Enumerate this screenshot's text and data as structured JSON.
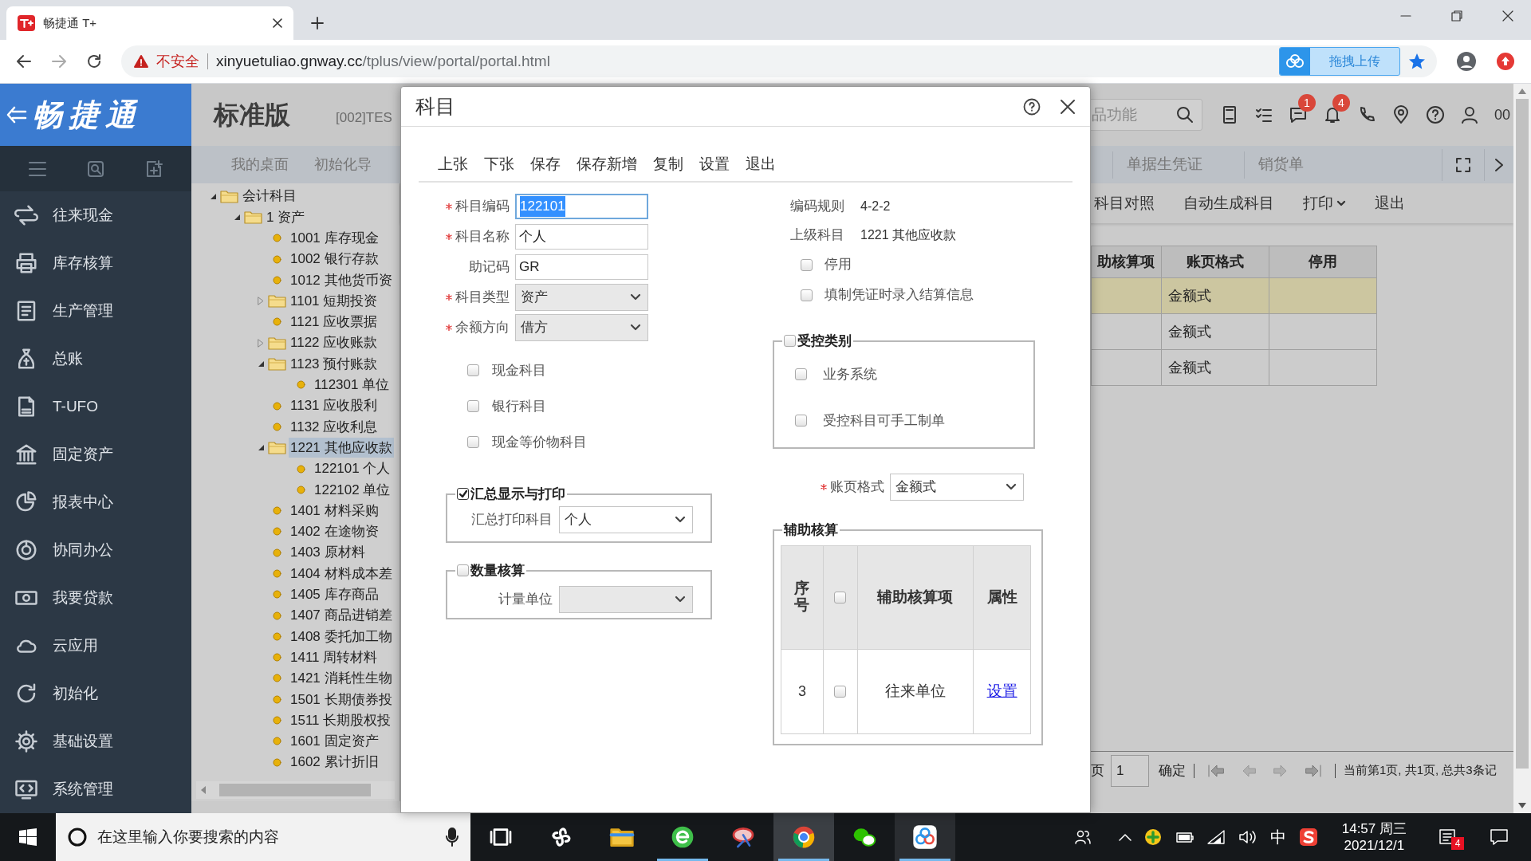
{
  "browser": {
    "tab": {
      "title": "畅捷通 T+"
    },
    "address": {
      "security": "不安全",
      "host": "xinyuetuliao.gnway.cc",
      "path": "/tplus/view/portal/portal.html"
    },
    "extension_button": "拖拽上传"
  },
  "app": {
    "logo": "畅捷通",
    "edition": "标准版",
    "account": "[002]TES",
    "search": {
      "placeholder": "品功能"
    },
    "badges": [
      "1",
      "4"
    ],
    "user_code": "00"
  },
  "sidebar": {
    "items": [
      "往来现金",
      "库存核算",
      "生产管理",
      "总账",
      "T-UFO",
      "固定资产",
      "报表中心",
      "协同办公",
      "我要贷款",
      "云应用",
      "初始化",
      "基础设置",
      "系统管理"
    ]
  },
  "tabs": [
    {
      "label": "我的桌面",
      "selected": false
    },
    {
      "label": "初始化导",
      "selected": false
    },
    {
      "label": "单据生凭证",
      "selected": false
    },
    {
      "label": "销货单",
      "selected": false
    }
  ],
  "toolbar": [
    {
      "label": "科目对照",
      "kind": "button"
    },
    {
      "label": "自动生成科目",
      "kind": "button"
    },
    {
      "label": "打印",
      "kind": "dropdown"
    },
    {
      "label": "退出",
      "kind": "button"
    }
  ],
  "tree": {
    "items": [
      {
        "label": "会计科目",
        "kind": "folder",
        "expanded": true,
        "selected": false,
        "children": [
          {
            "label": "1 资产",
            "kind": "folder",
            "expanded": true,
            "selected": false,
            "children": [
              {
                "label": "1001 库存现金",
                "kind": "leaf",
                "selected": false
              },
              {
                "label": "1002 银行存款",
                "kind": "leaf",
                "selected": false
              },
              {
                "label": "1012 其他货币资",
                "kind": "leaf",
                "selected": false
              },
              {
                "label": "1101 短期投资",
                "kind": "folder",
                "expanded": false,
                "selected": false
              },
              {
                "label": "1121 应收票据",
                "kind": "leaf",
                "selected": false
              },
              {
                "label": "1122 应收账款",
                "kind": "folder",
                "expanded": false,
                "selected": false
              },
              {
                "label": "1123 预付账款",
                "kind": "folder",
                "expanded": true,
                "selected": false,
                "children": [
                  {
                    "label": "112301 单位",
                    "kind": "leaf",
                    "selected": false
                  }
                ]
              },
              {
                "label": "1131 应收股利",
                "kind": "leaf",
                "selected": false
              },
              {
                "label": "1132 应收利息",
                "kind": "leaf",
                "selected": false
              },
              {
                "label": "1221 其他应收款",
                "kind": "folder",
                "expanded": true,
                "selected": true,
                "children": [
                  {
                    "label": "122101 个人",
                    "kind": "leaf",
                    "selected": false
                  },
                  {
                    "label": "122102 单位",
                    "kind": "leaf",
                    "selected": false
                  }
                ]
              },
              {
                "label": "1401 材料采购",
                "kind": "leaf",
                "selected": false
              },
              {
                "label": "1402 在途物资",
                "kind": "leaf",
                "selected": false
              },
              {
                "label": "1403 原材料",
                "kind": "leaf",
                "selected": false
              },
              {
                "label": "1404 材料成本差",
                "kind": "leaf",
                "selected": false
              },
              {
                "label": "1405 库存商品",
                "kind": "leaf",
                "selected": false
              },
              {
                "label": "1407 商品进销差",
                "kind": "leaf",
                "selected": false
              },
              {
                "label": "1408 委托加工物",
                "kind": "leaf",
                "selected": false
              },
              {
                "label": "1411 周转材料",
                "kind": "leaf",
                "selected": false
              },
              {
                "label": "1421 消耗性生物",
                "kind": "leaf",
                "selected": false
              },
              {
                "label": "1501 长期债券投",
                "kind": "leaf",
                "selected": false
              },
              {
                "label": "1511 长期股权投",
                "kind": "leaf",
                "selected": false
              },
              {
                "label": "1601 固定资产",
                "kind": "leaf",
                "selected": false
              },
              {
                "label": "1602 累计折旧",
                "kind": "leaf",
                "selected": false
              }
            ]
          }
        ]
      }
    ]
  },
  "grid": {
    "columns": [
      "助核算项",
      "账页格式",
      "停用"
    ],
    "rows": [
      {
        "format": "金额式",
        "selected": true
      },
      {
        "format": "金额式",
        "selected": false
      },
      {
        "format": "金额式",
        "selected": false
      }
    ]
  },
  "pager": {
    "label": "页",
    "page": "1",
    "confirm": "确定",
    "summary": "当前第1页, 共1页, 总共3条记"
  },
  "dialog": {
    "title": "科目",
    "toolbar": [
      "上张",
      "下张",
      "保存",
      "保存新增",
      "复制",
      "设置",
      "退出"
    ],
    "fields": [
      {
        "label": "科目编码",
        "required": true,
        "kind": "text",
        "value": "122101",
        "focused": true
      },
      {
        "label": "科目名称",
        "required": true,
        "kind": "text",
        "value": "个人",
        "focused": false
      },
      {
        "label": "助记码",
        "required": false,
        "kind": "text",
        "value": "GR",
        "focused": false
      },
      {
        "label": "科目类型",
        "required": true,
        "kind": "select",
        "value": "资产",
        "focused": false
      },
      {
        "label": "余额方向",
        "required": true,
        "kind": "select",
        "value": "借方",
        "focused": false
      }
    ],
    "checks": [
      {
        "label": "现金科目",
        "checked": false
      },
      {
        "label": "银行科目",
        "checked": false
      },
      {
        "label": "现金等价物科目",
        "checked": false
      }
    ],
    "summary_group": {
      "label": "汇总显示与打印",
      "checked": true,
      "field_label": "汇总打印科目",
      "value": "个人"
    },
    "quantity_group": {
      "label": "数量核算",
      "checked": false,
      "field_label": "计量单位"
    },
    "info": [
      {
        "label": "编码规则",
        "value": "4-2-2"
      },
      {
        "label": "上级科目",
        "value": "1221 其他应收款"
      }
    ],
    "options": [
      {
        "label": "停用",
        "checked": false
      },
      {
        "label": "填制凭证时录入结算信息",
        "checked": false
      }
    ],
    "control_group": {
      "label": "受控类别",
      "checked": false,
      "items": [
        {
          "label": "业务系统",
          "checked": false
        },
        {
          "label": "受控科目可手工制单",
          "checked": false
        }
      ]
    },
    "ledger_format": {
      "label": "账页格式",
      "required": true,
      "value": "金额式"
    },
    "aux": {
      "label": "辅助核算",
      "columns": [
        "序号",
        "辅助核算项",
        "属性"
      ],
      "header_checked": false,
      "rows": [
        {
          "index": "3",
          "checked": false,
          "item": "往来单位",
          "action": "设置"
        }
      ]
    }
  },
  "taskbar": {
    "search_placeholder": "在这里输入你要搜索的内容",
    "ime": "中",
    "time": "14:57 周三",
    "date": "2021/12/1",
    "notification_count": "4"
  }
}
